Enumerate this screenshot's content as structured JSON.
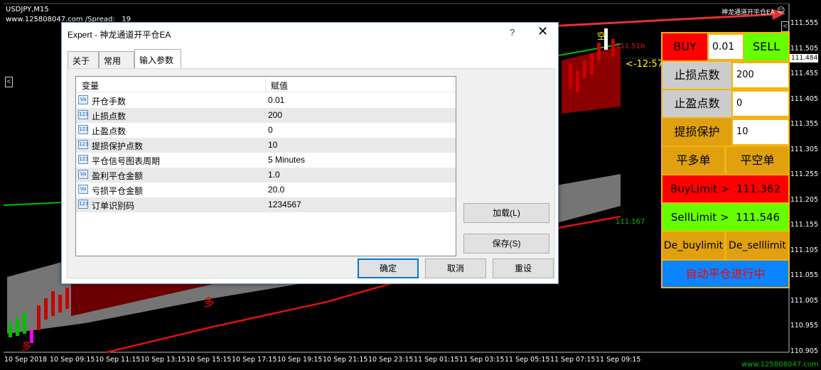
{
  "chart": {
    "symbol": "USDJPY,M15",
    "watermark_url": "www.125808047.com",
    "spread_label": "/Spread:",
    "spread_value": "19",
    "ea_title": "神龙通道开平仓EA",
    "price_tag": "111.516",
    "countdown": "<-12:57",
    "lower_tag": "111.167",
    "current_price": "111.484",
    "marker_up": "空",
    "marker_down": "多",
    "marker_left": "多",
    "left_arrow": "<",
    "right_arrow": "<",
    "footer_url": "www.125808047.com",
    "price_axis": [
      "111.555",
      "111.505",
      "111.455",
      "111.405",
      "111.355",
      "111.305",
      "111.255",
      "111.205",
      "111.155",
      "111.105",
      "111.055",
      "111.005",
      "110.955",
      "110.905"
    ],
    "time_axis": [
      "10 Sep 2018",
      "10 Sep 09:15",
      "10 Sep 11:15",
      "10 Sep 13:15",
      "10 Sep 15:15",
      "10 Sep 17:15",
      "10 Sep 19:15",
      "10 Sep 21:15",
      "10 Sep 23:15",
      "11 Sep 01:15",
      "11 Sep 03:15",
      "11 Sep 05:15",
      "11 Sep 07:15",
      "11 Sep 09:15"
    ],
    "colors": {
      "green_line": "#00c000",
      "red_line": "#e01010",
      "band_gray": "#8a8a8a",
      "band_red": "#8b0000",
      "arrow_red": "#e83030"
    }
  },
  "dialog": {
    "title": "Expert - 神龙通道开平仓EA",
    "help": "?",
    "close": "✕",
    "tabs": [
      "关于",
      "常用",
      "输入参数"
    ],
    "active_tab": 2,
    "columns": [
      "变量",
      "赋值"
    ],
    "rows": [
      {
        "icon": "Va",
        "name": "开仓手数",
        "value": "0.01"
      },
      {
        "icon": "123",
        "name": "止损点数",
        "value": "200"
      },
      {
        "icon": "123",
        "name": "止盈点数",
        "value": "0"
      },
      {
        "icon": "123",
        "name": "提损保护点数",
        "value": "10"
      },
      {
        "icon": "123",
        "name": "平仓信号图表周期",
        "value": "5 Minutes"
      },
      {
        "icon": "Va",
        "name": "盈利平仓金额",
        "value": "1.0"
      },
      {
        "icon": "Va",
        "name": "亏损平仓金额",
        "value": "20.0"
      },
      {
        "icon": "123",
        "name": "订单识别码",
        "value": "1234567"
      }
    ],
    "load_button": "加载(L)",
    "save_button": "保存(S)",
    "ok_button": "确定",
    "cancel_button": "取消",
    "reset_button": "重设"
  },
  "panel": {
    "buy": "BUY",
    "lot": "0.01",
    "sell": "SELL",
    "sl_label": "止损点数",
    "sl_value": "200",
    "tp_label": "止盈点数",
    "tp_value": "0",
    "protect_label": "提损保护",
    "protect_value": "10",
    "close_long": "平多单",
    "close_short": "平空单",
    "buylimit": "BuyLimit >",
    "buylimit_value": "111.362",
    "selllimit": "SellLimit >",
    "selllimit_value": "111.546",
    "de_buylimit": "De_buylimit",
    "de_selllimit": "De_selllimit",
    "auto_close": "自动平仓进行中",
    "colors": {
      "frame": "#f2b40e",
      "red": "#ff0000",
      "green": "#66ff00",
      "gray": "#cccccc",
      "gold": "#e0a010",
      "blue": "#0a84ff",
      "auto_text": "#ff0000"
    }
  }
}
